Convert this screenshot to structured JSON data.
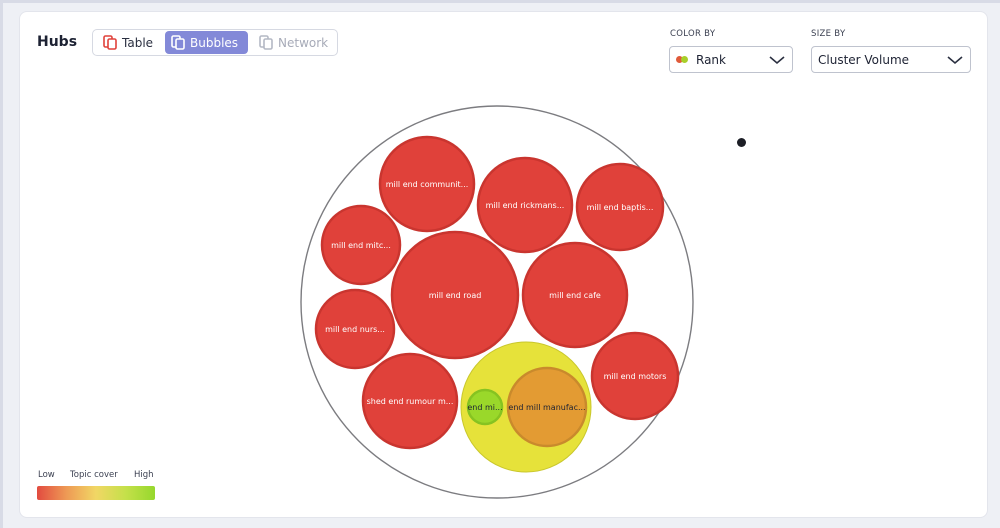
{
  "header": {
    "title": "Hubs"
  },
  "view_toggle": {
    "table_label": "Table",
    "bubbles_label": "Bubbles",
    "network_label": "Network",
    "active": "Bubbles"
  },
  "controls": {
    "color_by": {
      "label": "COLOR BY",
      "value": "Rank",
      "dot_colors": [
        "#e05a3a",
        "#a8cf2a"
      ]
    },
    "size_by": {
      "label": "SIZE BY",
      "value": "Cluster Volume"
    }
  },
  "legend": {
    "low": "Low",
    "title": "Topic cover",
    "high": "High"
  },
  "bubbles": [
    {
      "label": "mill end communit...",
      "color": "#e0413a"
    },
    {
      "label": "mill end rickmans...",
      "color": "#e0413a"
    },
    {
      "label": "mill end baptis...",
      "color": "#e0413a"
    },
    {
      "label": "mill end mitc...",
      "color": "#e0413a"
    },
    {
      "label": "mill end road",
      "color": "#e0413a"
    },
    {
      "label": "mill end cafe",
      "color": "#e0413a"
    },
    {
      "label": "mill end nurs...",
      "color": "#e0413a"
    },
    {
      "label": "mill end motors",
      "color": "#e0413a"
    },
    {
      "label": "shed end rumour m...",
      "color": "#e0413a"
    },
    {
      "label": "end mi...",
      "color": "#9ad82a"
    },
    {
      "label": "end mill manufac...",
      "color": "#e39b33"
    }
  ],
  "colors": {
    "accent": "#8389d8",
    "cluster_fill": "#e6e23a"
  }
}
